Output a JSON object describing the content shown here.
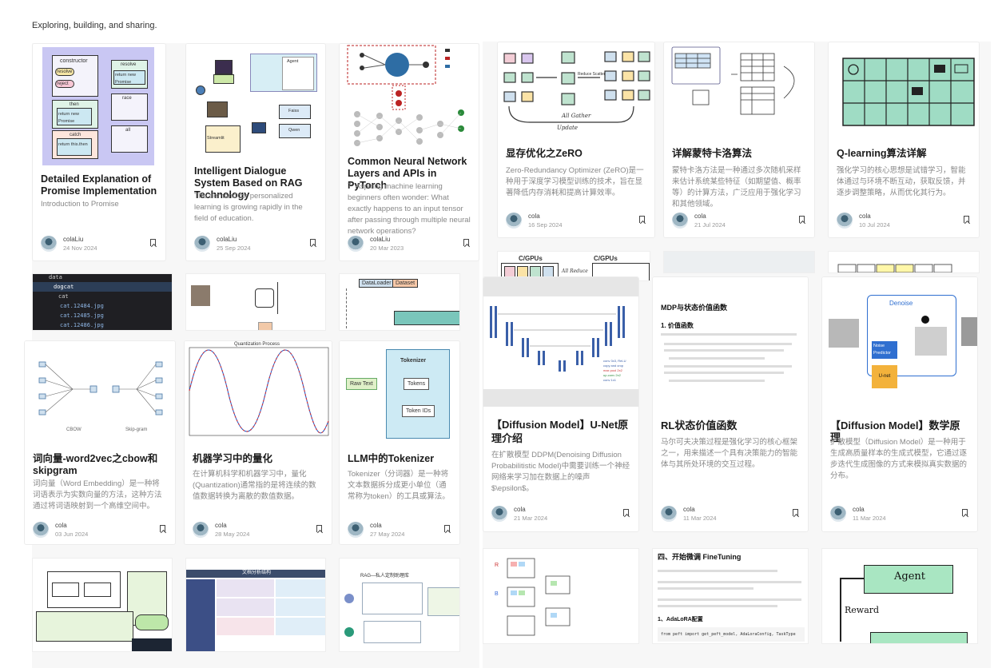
{
  "tagline": "Exploring, building, and sharing.",
  "cards": [
    {
      "title": "Detailed Explanation of Promise Implementation",
      "desc": "Introduction to Promise",
      "author": "colaLiu",
      "date": "24 Nov 2024"
    },
    {
      "title": "Intelligent Dialogue System Based on RAG Technology",
      "desc": "The demand for personalized learning is growing rapidly in the field of education.",
      "author": "colaLiu",
      "date": "25 Sep 2024"
    },
    {
      "title": "Common Neural Network Layers and APIs in PyTorch",
      "desc": "？Aspiring machine learning beginners often wonder: What exactly happens to an input tensor after passing through multiple neural network operations?",
      "author": "colaLiu",
      "date": "20 Mar 2023"
    },
    {
      "title": "显存优化之ZeRO",
      "desc": "Zero-Redundancy Optimizer (ZeRO)是一种用于深度学习模型训练的技术，旨在显著降低内存消耗和提高计算效率。",
      "author": "cola",
      "date": "16 Sep 2024"
    },
    {
      "title": "详解蒙特卡洛算法",
      "desc": "蒙特卡洛方法是一种通过多次随机采样来估计系统某些特征（如期望值、概率等）的计算方法，广泛应用于强化学习和其他领域。",
      "author": "cola",
      "date": "21 Jul 2024"
    },
    {
      "title": "Q-learning算法详解",
      "desc": "强化学习的核心思想是试错学习，智能体通过与环境不断互动，获取反馈，并逐步调整策略，从而优化其行为。",
      "author": "cola",
      "date": "10 Jul 2024"
    },
    {
      "title": "词向量-word2vec之cbow和skipgram",
      "desc": "词向量（Word Embedding）是一种将词语表示为实数向量的方法，这种方法通过将词语映射到一个高维空间中。",
      "author": "cola",
      "date": "03 Jun 2024"
    },
    {
      "title": "机器学习中的量化",
      "desc": "在计算机科学和机器学习中，量化(Quantization)通常指的是将连续的数值数据转换为离散的数值数据。",
      "author": "cola",
      "date": "28 May 2024"
    },
    {
      "title": "LLM中的Tokenizer",
      "desc": "Tokenizer（分词器）是一种将文本数据拆分成更小单位（通常称为token）的工具或算法。",
      "author": "cola",
      "date": "27 May 2024"
    },
    {
      "title": "【Diffusion Model】U-Net原理介绍",
      "desc": "在扩散模型 DDPM(Denoising Diffusion Probabilitistic Model)中需要训练一个神经网络来学习加在数据上的噪声 $\\epsilon$。",
      "author": "cola",
      "date": "21 Mar 2024"
    },
    {
      "title": "RL状态价值函数",
      "desc": "马尔可夫决策过程是强化学习的核心框架之一，用来描述一个具有决策能力的智能体与其所处环境的交互过程。",
      "author": "cola",
      "date": "11 Mar 2024"
    },
    {
      "title": "【Diffusion Model】数学原理",
      "desc": "扩散模型（Diffusion Model）是一种用于生成高质量样本的生成式模型，它通过逐步迭代生成图像的方式来模拟真实数据的分布。",
      "author": "cola",
      "date": "11 Mar 2024"
    }
  ],
  "thumb_text": {
    "promise": [
      "constructor",
      "resolve",
      "reject",
      "then",
      "return new Promise",
      "catch",
      "return this.then",
      "resolve",
      "return new Promise",
      "race",
      "all"
    ],
    "rag": [
      "Agent",
      "Faiss",
      "Qwen",
      "Streamlit"
    ],
    "tokenizer": [
      "Tokenizer",
      "Raw Text",
      "Tokens",
      "Token IDs"
    ],
    "quant": "Quantization Process",
    "zero": [
      "All Gather",
      "Reduce Scatter",
      "Update"
    ],
    "mdp_title": "MDP与状态价值函数",
    "mdp_sub": "1. 价值函数",
    "denoise": [
      "Denoise",
      "Noise Predictor",
      "U-net"
    ],
    "finetune_title": "四、开始微调 FineTuning",
    "finetune_sub": "1、AdaLoRA配置",
    "finetune_code": "from peft import get_peft_model, AdaLoraConfig, TaskType",
    "agent": [
      "Agent",
      "Reward"
    ],
    "cgpu": [
      "C/GPUs",
      "All Reduce",
      "C/GPUs"
    ],
    "dataloader": [
      "DataLoader",
      "Dataset"
    ],
    "tree": [
      "data",
      "dogcat",
      "cat",
      "cat.12484.jpg",
      "cat.12485.jpg",
      "cat.12486.jpg"
    ],
    "rag2": "RAG—私人定制助理库",
    "doc_title": "文档分析结构"
  }
}
